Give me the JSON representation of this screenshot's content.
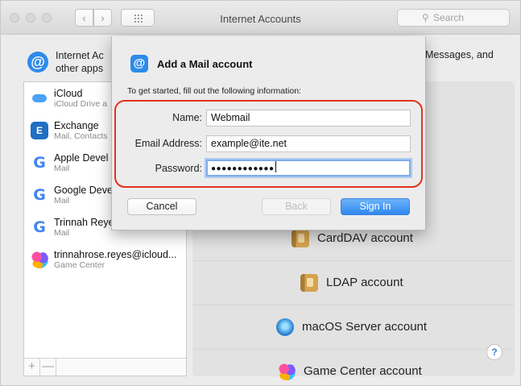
{
  "window": {
    "title": "Internet Accounts",
    "search_placeholder": "Search",
    "nav_back": "‹",
    "nav_forward": "›"
  },
  "header": {
    "icon": "at-icon",
    "text_line1": "Internet Ac",
    "text_line2": "other apps",
    "text_right": "Messages, and"
  },
  "sidebar": {
    "accounts": [
      {
        "name": "iCloud",
        "sub": "iCloud Drive a",
        "icon": "icloud-icon"
      },
      {
        "name": "Exchange",
        "sub": "Mail, Contacts",
        "icon": "exchange-icon"
      },
      {
        "name": "Apple Devel",
        "sub": "Mail",
        "icon": "google-icon"
      },
      {
        "name": "Google Deve",
        "sub": "Mail",
        "icon": "google-icon"
      },
      {
        "name": "Trinnah Reye",
        "sub": "Mail",
        "icon": "google-icon"
      },
      {
        "name": "trinnahrose.reyes@icloud...",
        "sub": "Game Center",
        "icon": "game-center-icon"
      }
    ],
    "add_label": "+",
    "remove_label": "—"
  },
  "providers": [
    {
      "label": "CardDAV account",
      "icon": "contacts-book-icon"
    },
    {
      "label": "LDAP account",
      "icon": "contacts-book-icon"
    },
    {
      "label": "macOS Server account",
      "icon": "macos-server-icon"
    },
    {
      "label": "Game Center account",
      "icon": "game-center-icon"
    }
  ],
  "help_label": "?",
  "sheet": {
    "title": "Add a Mail account",
    "intro": "To get started, fill out the following information:",
    "fields": {
      "name_label": "Name:",
      "name_value": "Webmail",
      "email_label": "Email Address:",
      "email_value": "example@ite.net",
      "password_label": "Password:",
      "password_value": "●●●●●●●●●●●●"
    },
    "buttons": {
      "cancel": "Cancel",
      "back": "Back",
      "sign_in": "Sign In"
    },
    "highlight_color": "#e2311d",
    "accent_color": "#2f87ef"
  }
}
